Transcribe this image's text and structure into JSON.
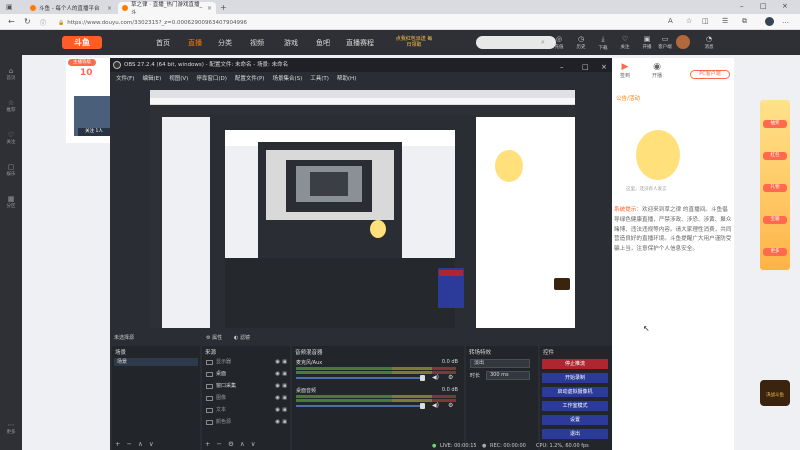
{
  "browser": {
    "tabs": [
      {
        "label": "斗鱼 - 每个人的直播平台",
        "active": false
      },
      {
        "label": "草之律 · 直播_热门游戏直播_斗",
        "active": true
      }
    ],
    "url": "https://www.douyu.com/3302315?_z=0.00062900963407904996",
    "lock_icon": "lock-icon"
  },
  "site": {
    "logo": "斗鱼",
    "nav": [
      "首页",
      "直播",
      "分类",
      "视频",
      "游戏",
      "鱼吧",
      "直播赛程"
    ],
    "active_nav": "直播",
    "promo": "点我红包派送\n每日领取",
    "header_items": [
      "充值",
      "历史",
      "下载",
      "关注",
      "开播",
      "客户端",
      "消息"
    ],
    "left_rail": [
      "首页",
      "推荐",
      "关注",
      "娱乐",
      "分区",
      "更多"
    ],
    "streamer": {
      "level": "10",
      "level_badge": "主播等级",
      "name": "关注",
      "count": "1人"
    },
    "right": {
      "icons": [
        "签到",
        "开播"
      ],
      "pc_client": "PC客户端",
      "chat_head": "公告/活动",
      "mascot_caption": "这里，还没有人发言",
      "chat_highlight": "系统提示：",
      "chat_text": "欢迎来到草之律 的直播间。斗鱼倡导绿色健康直播，严禁涉政、涉恐、涉黄、聚众赌博、违法违规等内容。请大家理性消费，共同营造良好的直播环境。斗鱼提醒广大用户谨防受骗上当，注意保护个人信息安全。"
    },
    "promo_col": [
      "抽奖",
      "红包",
      "礼物",
      "宝箱",
      "更多"
    ],
    "game_badge": "决战斗鱼"
  },
  "obs": {
    "title": "OBS 27.2.4 (64 bit, windows) - 配置文件: 未命名 - 场景: 未命名",
    "menu": [
      "文件(F)",
      "编辑(E)",
      "视图(V)",
      "停靠窗口(D)",
      "配置文件(P)",
      "场景集合(S)",
      "工具(T)",
      "帮助(H)"
    ],
    "scene_bar": [
      "未选择源",
      "属性",
      "滤镜"
    ],
    "scenes": {
      "title": "场景",
      "items": [
        "场景"
      ],
      "footer": "+ − ∧ ∨"
    },
    "sources": {
      "title": "来源",
      "items": [
        {
          "label": "显示器",
          "on": false
        },
        {
          "label": "桌面",
          "on": true
        },
        {
          "label": "窗口采集",
          "on": true
        },
        {
          "label": "图像",
          "on": false
        },
        {
          "label": "文本",
          "on": false
        },
        {
          "label": "颜色源",
          "on": false
        }
      ],
      "footer": "+ − ⚙ ∧ ∨"
    },
    "mixer": {
      "title": "音频混音器",
      "channels": [
        {
          "label": "麦克风/Aux",
          "db": "0.0 dB"
        },
        {
          "label": "桌面音频",
          "db": "0.0 dB"
        }
      ]
    },
    "transitions": {
      "title": "转场特效",
      "type": "淡出",
      "duration_label": "时长",
      "duration": "300 ms"
    },
    "controls": {
      "title": "控件",
      "buttons": [
        "停止推流",
        "开始录制",
        "启动虚拟摄像机",
        "工作室模式",
        "设置",
        "退出"
      ]
    },
    "status": {
      "live": "LIVE: 00:00:15",
      "rec": "REC: 00:00:00",
      "cpu": "CPU: 1.2%, 60.00 fps"
    }
  }
}
